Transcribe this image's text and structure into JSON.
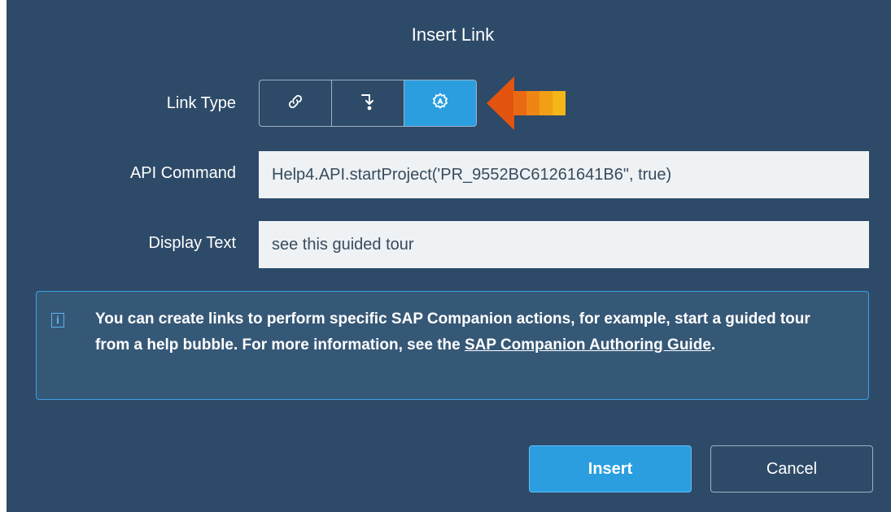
{
  "dialog": {
    "title": "Insert Link"
  },
  "link_type": {
    "label": "Link Type",
    "options": [
      {
        "icon": "link-icon",
        "active": false
      },
      {
        "icon": "step-arrow-icon",
        "active": false
      },
      {
        "icon": "api-gear-icon",
        "active": true
      }
    ]
  },
  "api_command": {
    "label": "API Command",
    "value": "Help4.API.startProject('PR_9552BC61261641B6\", true)"
  },
  "display_text": {
    "label": "Display Text",
    "value": "see this guided tour"
  },
  "info": {
    "text_before": "You can create links to perform specific SAP Companion actions, for example, start a guided tour from a help bubble. For more information, see the ",
    "link_text": "SAP Companion Authoring Guide",
    "text_after": ".",
    "icon_glyph": "i"
  },
  "buttons": {
    "insert_label": "Insert",
    "cancel_label": "Cancel"
  },
  "colors": {
    "dialog_bg": "#2d4a68",
    "accent": "#2b9ee0",
    "arrow": "#e65a10"
  }
}
